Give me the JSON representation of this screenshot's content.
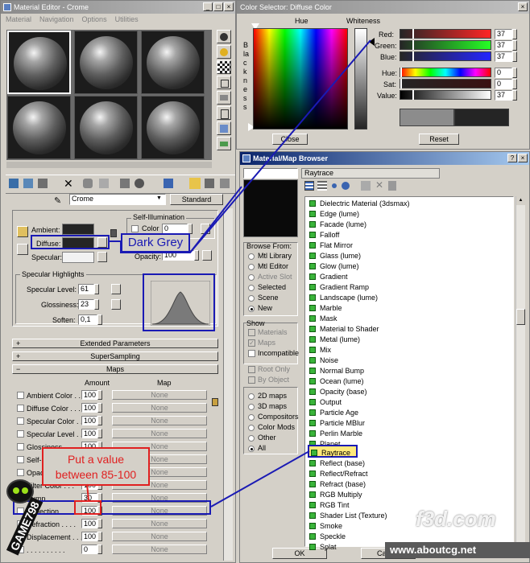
{
  "material_editor": {
    "title": "Material Editor - Crome",
    "menu": [
      "Material",
      "Navigation",
      "Options",
      "Utilities"
    ],
    "material_name": "Crome",
    "material_type": "Standard",
    "self_illum_label": "Self-Illumination",
    "color_label": "Color",
    "self_illum_value": "0",
    "opacity_label": "Opacity:",
    "opacity_value": "100",
    "ambient_label": "Ambient:",
    "diffuse_label": "Diffuse:",
    "specular_label": "Specular:",
    "specular_highlights_title": "Specular Highlights",
    "specular_level_label": "Specular Level:",
    "specular_level_value": "61",
    "glossiness_label": "Glossiness:",
    "glossiness_value": "23",
    "soften_label": "Soften:",
    "soften_value": "0,1",
    "rollups": {
      "extended": "Extended Parameters",
      "supersampling": "SuperSampling",
      "maps": "Maps"
    },
    "maps_header": {
      "amount": "Amount",
      "map": "Map"
    },
    "maps_rows": [
      {
        "label": "Ambient Color . . .",
        "amount": "100",
        "map": "None"
      },
      {
        "label": "Diffuse Color . . .",
        "amount": "100",
        "map": "None"
      },
      {
        "label": "Specular Color . .",
        "amount": "100",
        "map": "None"
      },
      {
        "label": "Specular Level . .",
        "amount": "100",
        "map": "None"
      },
      {
        "label": "Glossiness . . . .",
        "amount": "100",
        "map": "None"
      },
      {
        "label": "Self-Illumination",
        "amount": "100",
        "map": "None"
      },
      {
        "label": "Opacity . . . . . .",
        "amount": "100",
        "map": "None"
      },
      {
        "label": "Filter Color . . .",
        "amount": "100",
        "map": "None"
      },
      {
        "label": "Bump . . . . . . . .",
        "amount": "30",
        "map": "None"
      },
      {
        "label": "Reflection . . . .",
        "amount": "100",
        "map": "None"
      },
      {
        "label": "Refraction . . . .",
        "amount": "100",
        "map": "None"
      },
      {
        "label": "Displacement . . .",
        "amount": "100",
        "map": "None"
      },
      {
        "label": ". . . . . . . . . .",
        "amount": "0",
        "map": "None"
      }
    ]
  },
  "color_selector": {
    "title": "Color Selector: Diffuse Color",
    "hue_label": "Hue",
    "whiteness_label": "Whiteness",
    "blackness_label": "Blackness",
    "channels": [
      {
        "label": "Red:",
        "value": "37"
      },
      {
        "label": "Green:",
        "value": "37"
      },
      {
        "label": "Blue:",
        "value": "37"
      },
      {
        "label": "Hue:",
        "value": "0"
      },
      {
        "label": "Sat:",
        "value": "0"
      },
      {
        "label": "Value:",
        "value": "37"
      }
    ],
    "close_label": "Close",
    "reset_label": "Reset",
    "color_value": "#252525"
  },
  "browser": {
    "title": "Material/Map Browser",
    "selected_name": "Raytrace",
    "browse_from_title": "Browse From:",
    "browse_from": [
      {
        "label": "Mtl Library",
        "selected": false,
        "disabled": false
      },
      {
        "label": "Mtl Editor",
        "selected": false,
        "disabled": false
      },
      {
        "label": "Active Slot",
        "selected": false,
        "disabled": true
      },
      {
        "label": "Selected",
        "selected": false,
        "disabled": false
      },
      {
        "label": "Scene",
        "selected": false,
        "disabled": false
      },
      {
        "label": "New",
        "selected": true,
        "disabled": false
      }
    ],
    "show_title": "Show",
    "show_options": [
      {
        "label": "Materials",
        "checked": false,
        "disabled": true
      },
      {
        "label": "Maps",
        "checked": true,
        "disabled": true
      },
      {
        "label": "Incompatible",
        "checked": false,
        "disabled": false
      }
    ],
    "root_only_label": "Root Only",
    "by_object_label": "By Object",
    "map_categories": [
      {
        "label": "2D maps",
        "selected": false
      },
      {
        "label": "3D maps",
        "selected": false
      },
      {
        "label": "Compositors",
        "selected": false
      },
      {
        "label": "Color Mods",
        "selected": false
      },
      {
        "label": "Other",
        "selected": false
      },
      {
        "label": "All",
        "selected": true
      }
    ],
    "list_items": [
      "Dielectric Material (3dsmax)",
      "Edge (lume)",
      "Facade (lume)",
      "Falloff",
      "Flat Mirror",
      "Glass (lume)",
      "Glow (lume)",
      "Gradient",
      "Gradient Ramp",
      "Landscape (lume)",
      "Marble",
      "Mask",
      "Material to Shader",
      "Metal (lume)",
      "Mix",
      "Noise",
      "Normal Bump",
      "Ocean (lume)",
      "Opacity (base)",
      "Output",
      "Particle Age",
      "Particle MBlur",
      "Perlin Marble",
      "Planet",
      "Raytrace",
      "Reflect (base)",
      "Reflect/Refract",
      "Refract (base)",
      "RGB Multiply",
      "RGB Tint",
      "Shader List (Texture)",
      "Smoke",
      "Speckle",
      "Splat"
    ],
    "selected_item": "Raytrace",
    "ok_label": "OK",
    "cancel_label": "Cancel"
  },
  "annotations": {
    "dark_grey": "Dark Grey",
    "put_value_line1": "Put a value",
    "put_value_line2": "between 85-100",
    "callout_color": "#1a1ab4",
    "callout_red": "#e02020"
  },
  "watermarks": {
    "game_logo": "GAME798",
    "site_logo": "f3d.com",
    "site_url": "www.aboutcg.net"
  }
}
